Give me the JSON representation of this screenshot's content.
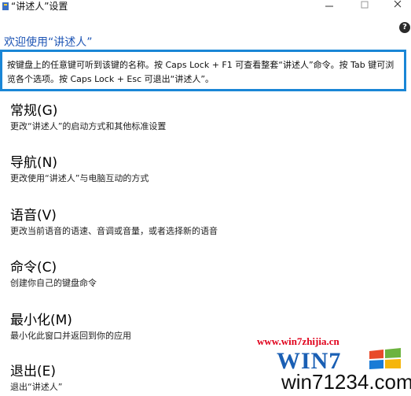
{
  "window": {
    "title": "“讲述人”设置",
    "icon": "narrator-app-icon"
  },
  "help_icon": "?",
  "welcome": "欢迎使用“讲述人”",
  "info_text": "按键盘上的任意键可听到该键的名称。按 Caps Lock + F1 可查看整套“讲述人”命令。按 Tab 键可浏览各个选项。按 Caps Lock + Esc 可退出“讲述人”。",
  "menu": [
    {
      "label": "常规(G)",
      "desc": "更改“讲述人”的启动方式和其他标准设置"
    },
    {
      "label": "导航(N)",
      "desc": "更改使用“讲述人”与电脑互动的方式"
    },
    {
      "label": "语音(V)",
      "desc": "更改当前语音的语速、音调或音量，或者选择新的语音"
    },
    {
      "label": "命令(C)",
      "desc": "创建你自己的键盘命令"
    },
    {
      "label": "最小化(M)",
      "desc": "最小化此窗口并返回到你的应用"
    },
    {
      "label": "退出(E)",
      "desc": "退出“讲述人”"
    }
  ],
  "watermark": {
    "url": "www.win7zhijia.cn",
    "logo_text": "WIN7",
    "domain": "win71234.com"
  },
  "colors": {
    "accent": "#1a86d6",
    "welcome": "#1f56b5",
    "watermark_red": "#e0001b",
    "logo_blue": "#1a5fb4"
  }
}
